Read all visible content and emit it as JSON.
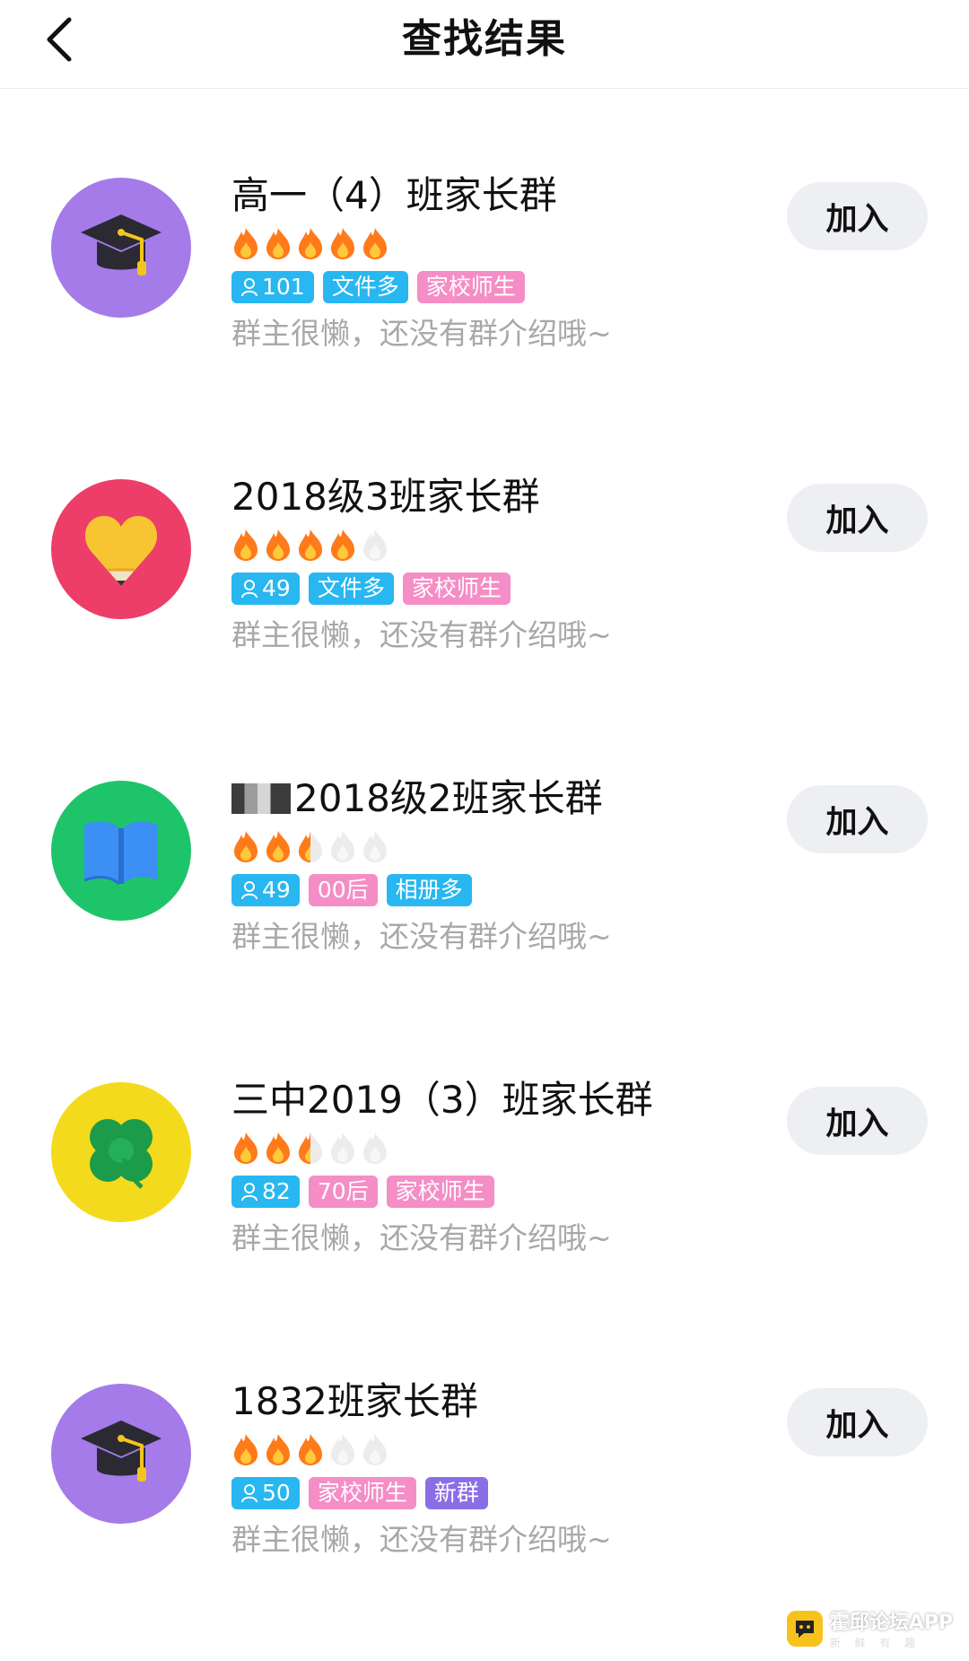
{
  "header": {
    "title": "查找结果",
    "back_icon": "chevron-left-icon"
  },
  "results": [
    {
      "name": "高一（4）班家长群",
      "avatar_icon": "graduation-cap-icon",
      "avatar_color": "#a47be8",
      "heat": 5,
      "tags": [
        {
          "text": "101",
          "kind": "members",
          "color": "#28b7f0"
        },
        {
          "text": "文件多",
          "kind": "label",
          "color": "#28b7f0"
        },
        {
          "text": "家校师生",
          "kind": "label",
          "color": "#f58dc6"
        }
      ],
      "description": "群主很懒，还没有群介绍哦~",
      "join_label": "加入"
    },
    {
      "name": "2018级3班家长群",
      "avatar_icon": "heart-pencil-icon",
      "avatar_color": "#ec3e68",
      "heat": 4,
      "tags": [
        {
          "text": "49",
          "kind": "members",
          "color": "#28b7f0"
        },
        {
          "text": "文件多",
          "kind": "label",
          "color": "#28b7f0"
        },
        {
          "text": "家校师生",
          "kind": "label",
          "color": "#f58dc6"
        }
      ],
      "description": "群主很懒，还没有群介绍哦~",
      "join_label": "加入"
    },
    {
      "name": "2018级2班家长群",
      "name_prefix_blurred": true,
      "avatar_icon": "book-icon",
      "avatar_color": "#1ec46a",
      "heat": 2.5,
      "tags": [
        {
          "text": "49",
          "kind": "members",
          "color": "#28b7f0"
        },
        {
          "text": "00后",
          "kind": "label",
          "color": "#f58dc6"
        },
        {
          "text": "相册多",
          "kind": "label",
          "color": "#28b7f0"
        }
      ],
      "description": "群主很懒，还没有群介绍哦~",
      "join_label": "加入"
    },
    {
      "name": "三中2019（3）班家长群",
      "avatar_icon": "clover-icon",
      "avatar_color": "#f4da1c",
      "heat": 2.5,
      "tags": [
        {
          "text": "82",
          "kind": "members",
          "color": "#28b7f0"
        },
        {
          "text": "70后",
          "kind": "label",
          "color": "#f58dc6"
        },
        {
          "text": "家校师生",
          "kind": "label",
          "color": "#f58dc6"
        }
      ],
      "description": "群主很懒，还没有群介绍哦~",
      "join_label": "加入"
    },
    {
      "name": "1832班家长群",
      "avatar_icon": "graduation-cap-icon",
      "avatar_color": "#a47be8",
      "heat": 3,
      "tags": [
        {
          "text": "50",
          "kind": "members",
          "color": "#28b7f0"
        },
        {
          "text": "家校师生",
          "kind": "label",
          "color": "#f58dc6"
        },
        {
          "text": "新群",
          "kind": "label",
          "color": "#8a6ee6"
        }
      ],
      "description": "群主很懒，还没有群介绍哦~",
      "join_label": "加入"
    }
  ],
  "watermark": {
    "name": "霍邱论坛APP",
    "sub": "新 鲜 有 趣",
    "icon": "chat-bubble-icon"
  }
}
